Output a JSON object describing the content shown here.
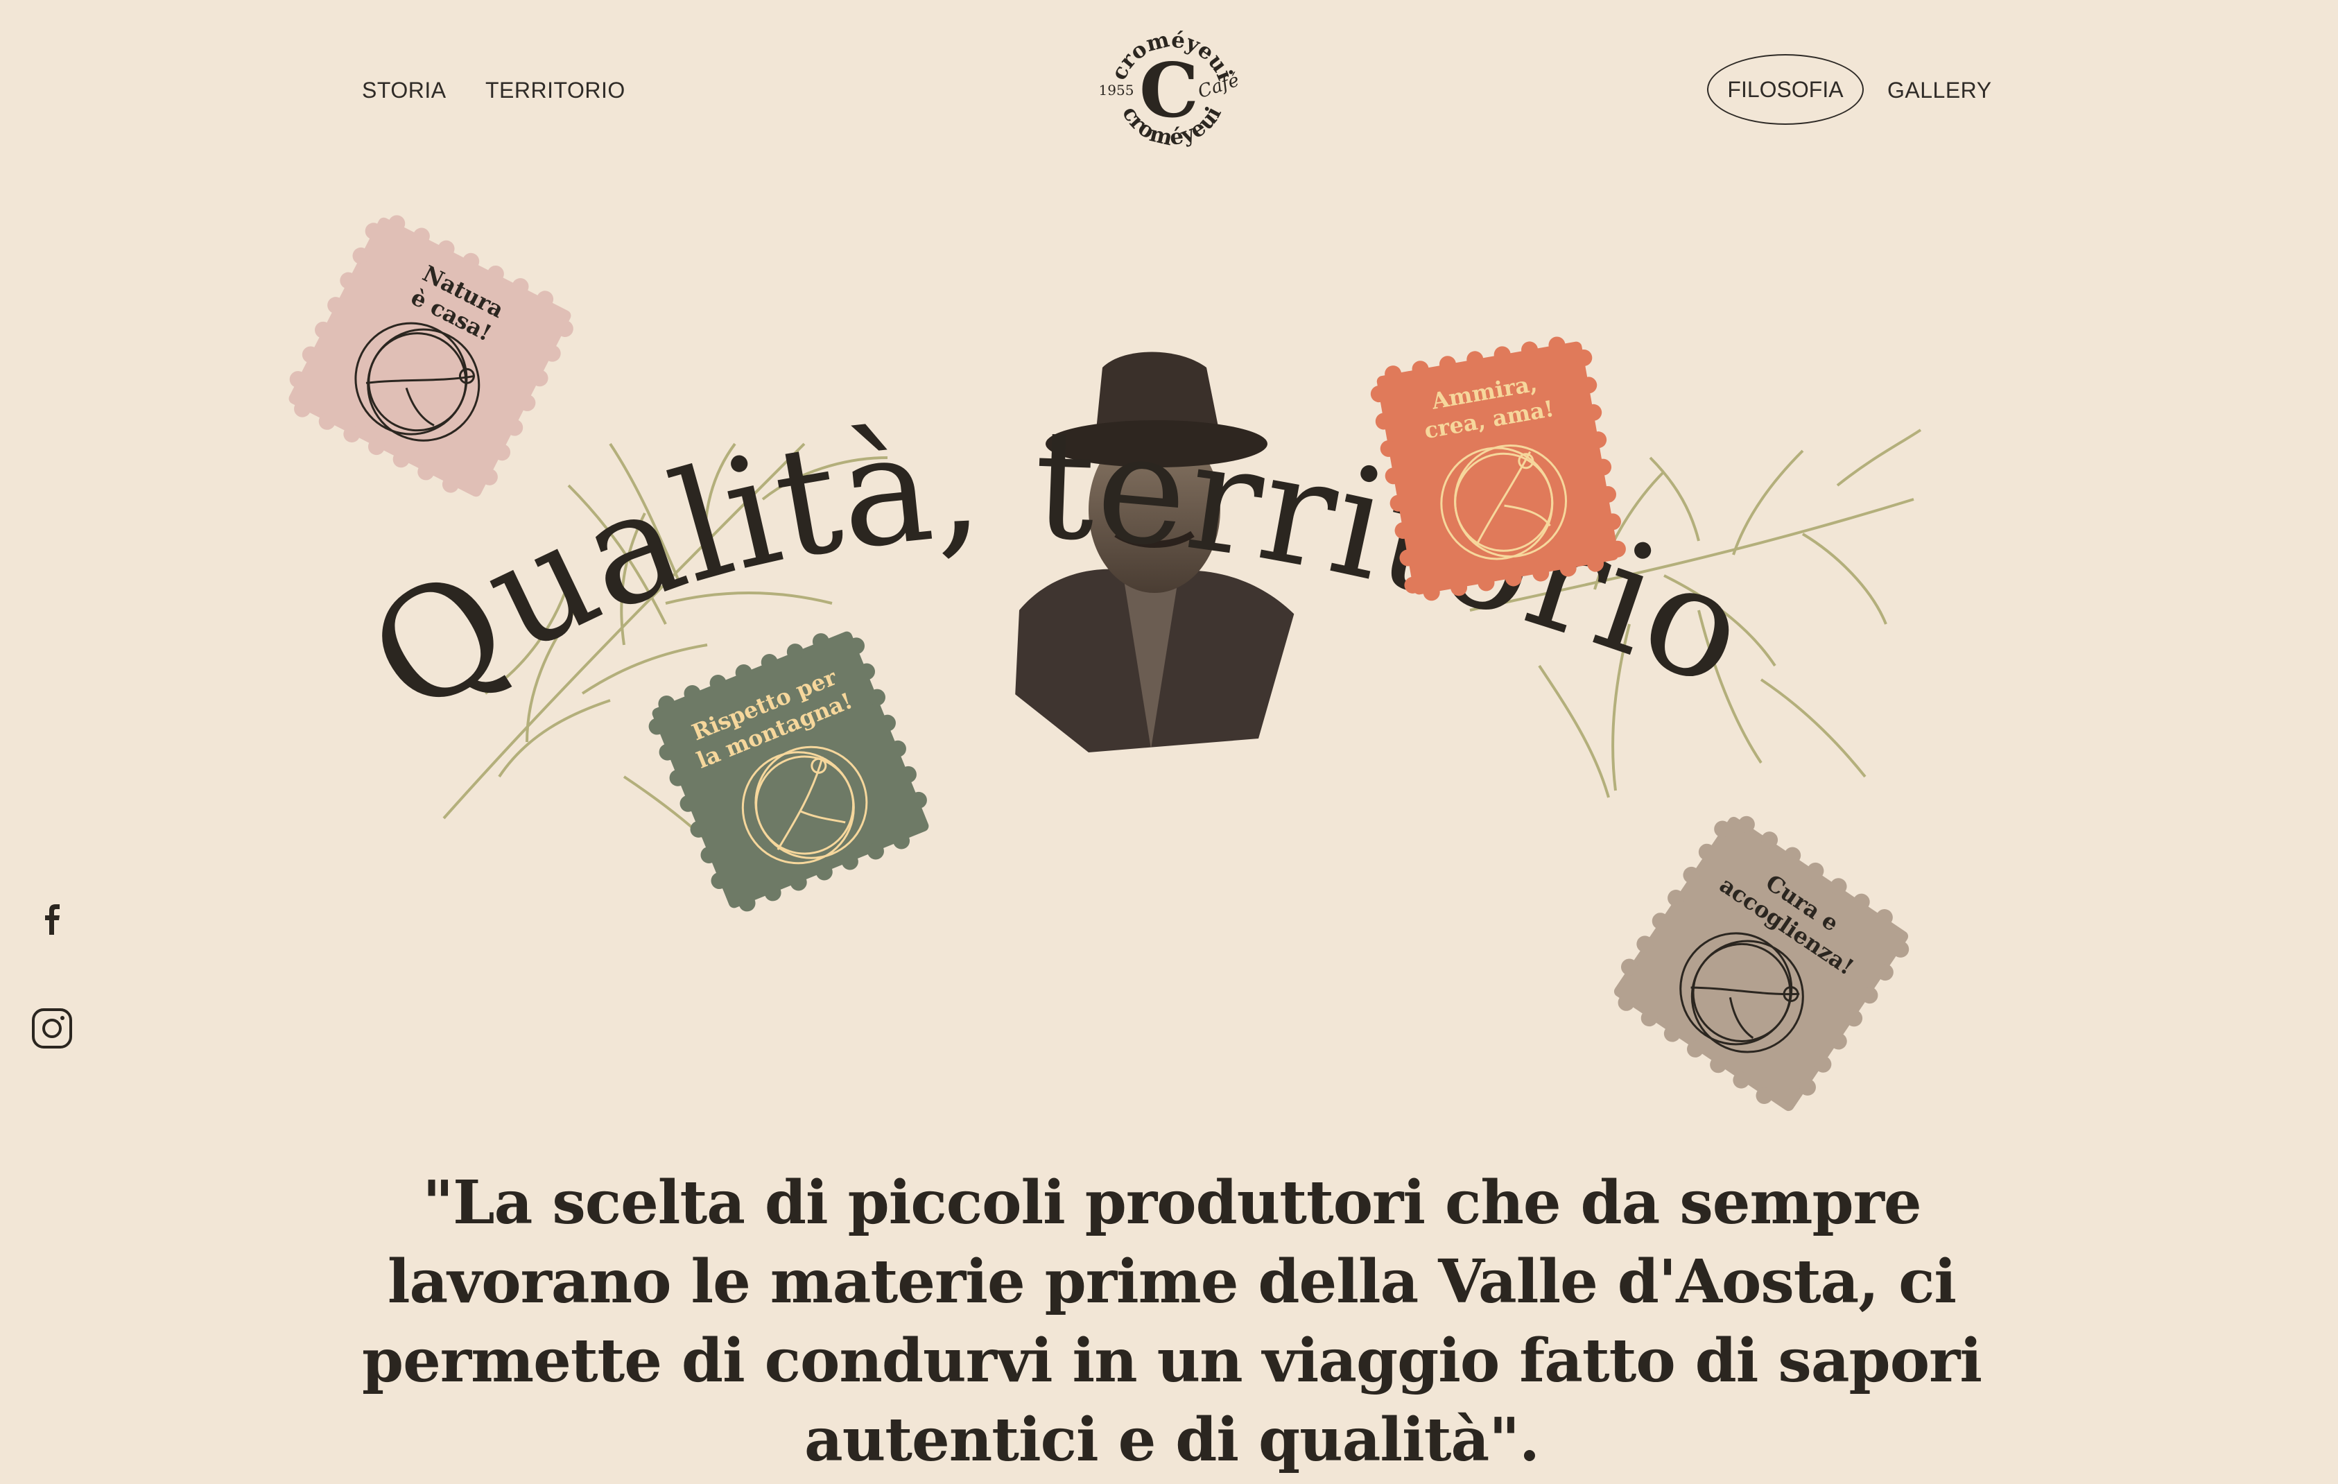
{
  "nav": {
    "left": [
      {
        "label": "STORIA"
      },
      {
        "label": "TERRITORIO"
      }
    ],
    "right": [
      {
        "label": "FILOSOFIA",
        "active": true
      },
      {
        "label": "GALLERY"
      }
    ]
  },
  "logo": {
    "brand": "croméyeui",
    "letter": "C",
    "sub": "Café",
    "year": "1955"
  },
  "hero": {
    "headline": "Qualità, territorio",
    "stamps": [
      {
        "text_line1": "Natura",
        "text_line2": "è casa!",
        "color": "#e0bfb6",
        "ink": "#2b2620"
      },
      {
        "text_line1": "Ammira,",
        "text_line2": "crea, ama!",
        "color": "#e07a5a",
        "ink": "#f6d79c"
      },
      {
        "text_line1": "Rispetto per",
        "text_line2": "la montagna!",
        "color": "#6e7a66",
        "ink": "#f6d79c"
      },
      {
        "text_line1": "Cura e",
        "text_line2": "accoglienza!",
        "color": "#b3a190",
        "ink": "#2b2620"
      }
    ],
    "colors": {
      "foliage": "#a9a66c",
      "ink": "#2b2620",
      "background": "#f2e6d6"
    }
  },
  "social": [
    {
      "icon": "facebook-icon"
    },
    {
      "icon": "instagram-icon"
    }
  ],
  "quote": {
    "text": "\"La scelta di piccoli produttori che da sempre lavorano le materie prime della Valle d'Aosta, ci permette di condurvi in un viaggio fatto di sapori autentici e di qualità\"."
  }
}
